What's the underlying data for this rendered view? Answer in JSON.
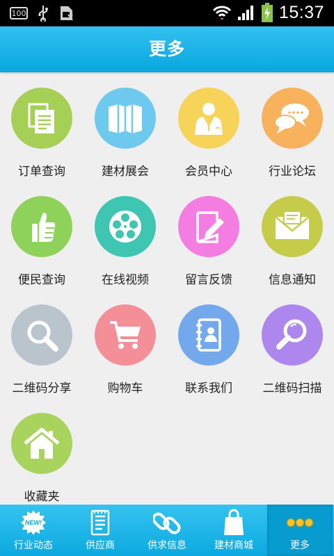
{
  "status_bar": {
    "battery_badge": "100",
    "time": "15:37",
    "icons": [
      "battery-100-icon",
      "usb-icon",
      "sim-icon",
      "wifi-icon",
      "signal-icon",
      "battery-charging-icon"
    ]
  },
  "header": {
    "title": "更多"
  },
  "menu": {
    "items": [
      {
        "label": "订单查询",
        "icon": "order-docs-icon",
        "color": "#a6cf55"
      },
      {
        "label": "建材展会",
        "icon": "map-icon",
        "color": "#6ec9ee"
      },
      {
        "label": "会员中心",
        "icon": "member-icon",
        "color": "#f8d35a"
      },
      {
        "label": "行业论坛",
        "icon": "chat-bubbles-icon",
        "color": "#f8b25e"
      },
      {
        "label": "便民查询",
        "icon": "thumbs-up-icon",
        "color": "#8fd25a"
      },
      {
        "label": "在线视频",
        "icon": "film-reel-icon",
        "color": "#3fc6b2"
      },
      {
        "label": "留言反馈",
        "icon": "edit-note-icon",
        "color": "#f47de2"
      },
      {
        "label": "信息通知",
        "icon": "envelope-icon",
        "color": "#c5cc4a"
      },
      {
        "label": "二维码分享",
        "icon": "magnifier-icon",
        "color": "#bac4cd"
      },
      {
        "label": "购物车",
        "icon": "shopping-cart-icon",
        "color": "#f48f98"
      },
      {
        "label": "联系我们",
        "icon": "contact-book-icon",
        "color": "#73a8ec"
      },
      {
        "label": "二维码扫描",
        "icon": "scan-magnifier-icon",
        "color": "#ad86ee"
      },
      {
        "label": "收藏夹",
        "icon": "home-icon",
        "color": "#a8d35d"
      }
    ]
  },
  "tab_bar": {
    "tabs": [
      {
        "label": "行业动态",
        "icon": "new-badge-icon",
        "active": false
      },
      {
        "label": "供应商",
        "icon": "document-list-icon",
        "active": false
      },
      {
        "label": "供求信息",
        "icon": "chain-link-icon",
        "active": false
      },
      {
        "label": "建材商城",
        "icon": "shopping-bag-icon",
        "active": false
      },
      {
        "label": "更多",
        "icon": "more-dots-icon",
        "active": true
      }
    ],
    "new_badge_text": "NEW!"
  }
}
